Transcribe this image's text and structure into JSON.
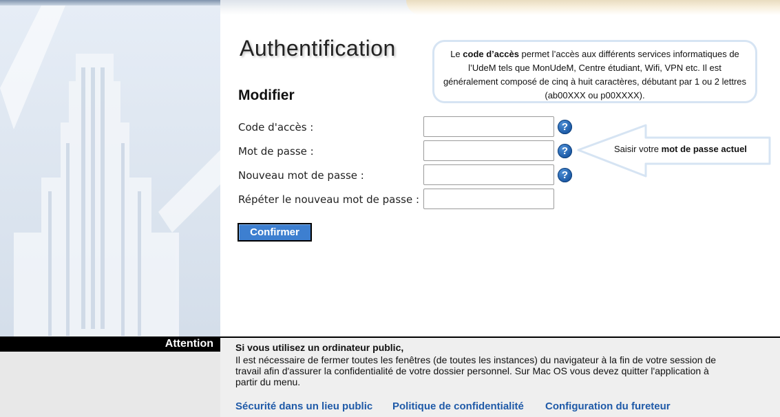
{
  "page": {
    "title": "Authentification",
    "subtitle": "Modifier"
  },
  "info_bubble": {
    "prefix": "Le ",
    "bold": "code d’accès",
    "text": " permet l’accès aux différents services informatiques de l’UdeM tels que MonUdeM, Centre étudiant, Wifi, VPN etc.  Il est généralement composé de cinq à huit caractères, débutant par 1 ou 2 lettres (ab00XXX ou p00XXXX)."
  },
  "form": {
    "fields": [
      {
        "label": "Code d'accès :",
        "value": "",
        "has_help": true
      },
      {
        "label": "Mot de passe :",
        "value": "",
        "has_help": true
      },
      {
        "label": "Nouveau mot de passe :",
        "value": "",
        "has_help": true
      },
      {
        "label": "Répéter le nouveau mot de passe :",
        "value": "",
        "has_help": false
      }
    ],
    "help_symbol": "?",
    "confirm_label": "Confirmer"
  },
  "arrow_hint": {
    "prefix": "Saisir votre ",
    "bold": "mot de passe actuel"
  },
  "attention": {
    "label": "Attention",
    "heading": "Si vous utilisez un ordinateur public,",
    "text": "Il est nécessaire de fermer toutes les fenêtres (de toutes les instances) du navigateur à la fin de votre session de travail afin d'assurer la confidentialité de votre dossier personnel. Sur Mac OS vous devez quitter l'application à partir du menu."
  },
  "footer_links": [
    "Sécurité dans un lieu public",
    "Politique de confidentialité",
    "Configuration du fureteur"
  ],
  "colors": {
    "accent_button": "#3d7fd0",
    "link": "#1f5aa8",
    "help_icon": "#1c5aa6"
  }
}
